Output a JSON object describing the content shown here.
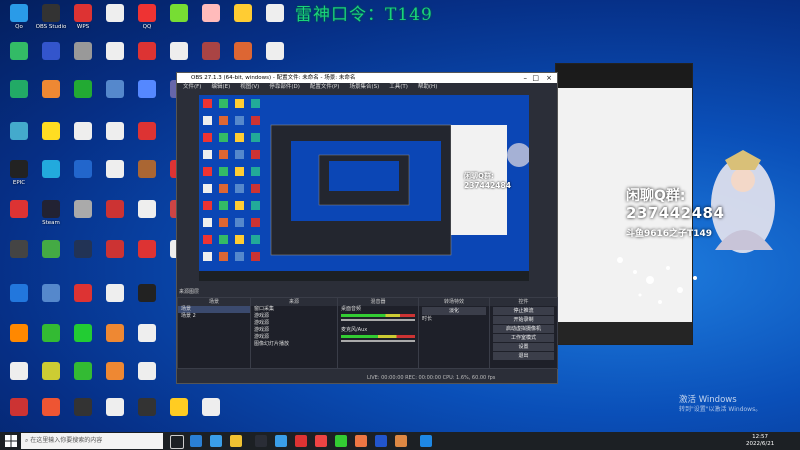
{
  "overlay_title": "雷神口令：T149",
  "desktop_icons": [
    {
      "label": "Qo",
      "color": "#2a9be8"
    },
    {
      "label": "OBS Studio",
      "color": "#333"
    },
    {
      "label": "WPS",
      "color": "#d33"
    },
    {
      "label": "",
      "color": "#eee"
    },
    {
      "label": "QQ",
      "color": "#e33"
    },
    {
      "label": "",
      "color": "#7d3"
    },
    {
      "label": "",
      "color": "#fbb"
    },
    {
      "label": "",
      "color": "#fc3"
    },
    {
      "label": "",
      "color": "#eee"
    },
    {
      "label": "",
      "color": "#3b6"
    },
    {
      "label": "",
      "color": "#35c"
    },
    {
      "label": "",
      "color": "#999"
    },
    {
      "label": "",
      "color": "#eee"
    },
    {
      "label": "",
      "color": "#d33"
    },
    {
      "label": "",
      "color": "#eee"
    },
    {
      "label": "",
      "color": "#a44"
    },
    {
      "label": "",
      "color": "#d63"
    },
    {
      "label": "",
      "color": "#eee"
    },
    {
      "label": "",
      "color": "#2a6"
    },
    {
      "label": "",
      "color": "#e83"
    },
    {
      "label": "",
      "color": "#2a3"
    },
    {
      "label": "",
      "color": "#58c"
    },
    {
      "label": "",
      "color": "#58f"
    },
    {
      "label": "",
      "color": "#66a"
    },
    {
      "label": "",
      "color": "#4ac"
    },
    {
      "label": "",
      "color": "#fd2"
    },
    {
      "label": "",
      "color": "#eee"
    },
    {
      "label": "",
      "color": "#eee"
    },
    {
      "label": "",
      "color": "#d33"
    },
    {
      "label": "EPIC",
      "color": "#222"
    },
    {
      "label": "",
      "color": "#2ad"
    },
    {
      "label": "",
      "color": "#26c"
    },
    {
      "label": "",
      "color": "#eee"
    },
    {
      "label": "",
      "color": "#a63"
    },
    {
      "label": "",
      "color": "#d33"
    },
    {
      "label": "",
      "color": "#d33"
    },
    {
      "label": "Steam",
      "color": "#223"
    },
    {
      "label": "",
      "color": "#aaa"
    },
    {
      "label": "",
      "color": "#c33"
    },
    {
      "label": "",
      "color": "#eee"
    },
    {
      "label": "",
      "color": "#c44"
    },
    {
      "label": "",
      "color": "#444"
    },
    {
      "label": "",
      "color": "#4a4"
    },
    {
      "label": "",
      "color": "#235"
    },
    {
      "label": "",
      "color": "#c33"
    },
    {
      "label": "",
      "color": "#d33"
    },
    {
      "label": "",
      "color": "#eee"
    },
    {
      "label": "",
      "color": "#27d"
    },
    {
      "label": "",
      "color": "#58c"
    },
    {
      "label": "",
      "color": "#d33"
    },
    {
      "label": "",
      "color": "#eee"
    },
    {
      "label": "",
      "color": "#222"
    },
    {
      "label": "",
      "color": "#f80"
    },
    {
      "label": "",
      "color": "#3b3"
    },
    {
      "label": "",
      "color": "#2c3"
    },
    {
      "label": "",
      "color": "#e83"
    },
    {
      "label": "",
      "color": "#eee"
    },
    {
      "label": "",
      "color": "#eee"
    },
    {
      "label": "",
      "color": "#cc3"
    },
    {
      "label": "",
      "color": "#3b3"
    },
    {
      "label": "",
      "color": "#e83"
    },
    {
      "label": "",
      "color": "#eee"
    },
    {
      "label": "",
      "color": "#c33"
    },
    {
      "label": "",
      "color": "#e53"
    },
    {
      "label": "",
      "color": "#333"
    },
    {
      "label": "",
      "color": "#eee"
    },
    {
      "label": "",
      "color": "#333"
    },
    {
      "label": "",
      "color": "#fc2"
    },
    {
      "label": "",
      "color": "#eee"
    }
  ],
  "obs": {
    "window_title": "OBS 27.1.3 (64-bit, windows) - 配置文件: 未命名 - 场景: 未命名",
    "menu": [
      "文件(F)",
      "编辑(E)",
      "视图(V)",
      "停靠部件(D)",
      "配置文件(P)",
      "场景集合(S)",
      "工具(T)",
      "帮助(H)"
    ],
    "scene_label": "来源图层",
    "docks": {
      "scenes": {
        "title": "场景",
        "items": [
          "场景",
          "场景 2"
        ]
      },
      "sources": {
        "title": "来源",
        "items": [
          "窗口采集",
          "游戏源",
          "游戏源",
          "游戏源",
          "游戏源",
          "图像幻灯片播放"
        ]
      },
      "mixer": {
        "title": "混音器",
        "items": [
          "桌面音频",
          "麦克风/Aux"
        ]
      },
      "transitions": {
        "title": "转场特效",
        "items": [
          "淡化",
          "时长"
        ]
      },
      "controls": {
        "title": "控件",
        "items": [
          "停止推流",
          "开始录制",
          "启动虚拟摄像机",
          "工作室模式",
          "设置",
          "退出"
        ]
      }
    },
    "status": "LIVE: 00:00:00   REC: 00:00:00   CPU: 1.6%, 60.00 fps"
  },
  "chat_overlay": {
    "qq_label": "闲聊Q群:",
    "qq_number": "237442484",
    "douyu": "斗鱼9616之子T149"
  },
  "watermark": {
    "line1": "激活 Windows",
    "line2": "转到\"设置\"以激活 Windows。"
  },
  "taskbar": {
    "search_placeholder": "在这里输入你要搜索的内容",
    "time": "12:57",
    "date": "2022/6/21"
  },
  "colors": {
    "overlay_green": "#19d37a",
    "obs_bg": "#2b2e38",
    "taskbar": "#1c2024",
    "desktop": "#0a4fb8"
  }
}
